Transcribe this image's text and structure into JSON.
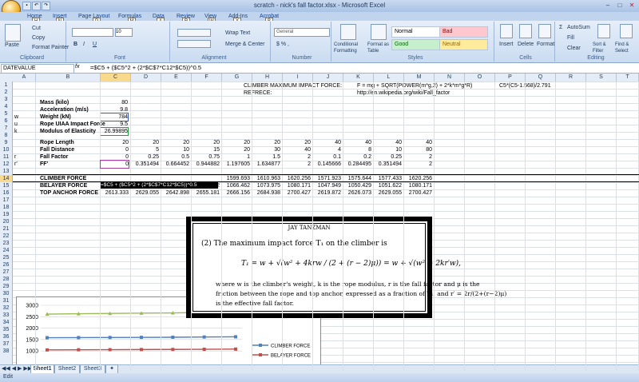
{
  "window": {
    "title": "scratch - nick's fall factor.xlsx - Microsoft Excel"
  },
  "tabs": [
    {
      "label": "Home",
      "key": "H"
    },
    {
      "label": "Insert",
      "key": "N"
    },
    {
      "label": "Page Layout",
      "key": "P"
    },
    {
      "label": "Formulas",
      "key": "M"
    },
    {
      "label": "Data",
      "key": "A"
    },
    {
      "label": "Review",
      "key": "R"
    },
    {
      "label": "View",
      "key": "W"
    },
    {
      "label": "Add-Ins",
      "key": "X"
    },
    {
      "label": "Acrobat",
      "key": "B"
    }
  ],
  "ribbon": {
    "clipboard": {
      "label": "Clipboard",
      "paste": "Paste",
      "cut": "Cut",
      "copy": "Copy",
      "format_painter": "Format Painter"
    },
    "font": {
      "label": "Font",
      "size": "10"
    },
    "alignment": {
      "label": "Alignment",
      "wrap": "Wrap Text",
      "merge": "Merge & Center"
    },
    "number": {
      "label": "Number",
      "format": "General"
    },
    "styles": {
      "label": "Styles",
      "conditional": "Conditional Formatting",
      "format_table": "Format as Table",
      "normal": "Normal",
      "bad": "Bad",
      "good": "Good",
      "neutral": "Neutral"
    },
    "cells": {
      "label": "Cells",
      "insert": "Insert",
      "delete": "Delete",
      "format": "Format"
    },
    "editing": {
      "label": "Editing",
      "autosum": "AutoSum",
      "fill": "Fill",
      "clear": "Clear",
      "sort": "Sort & Filter",
      "find": "Find & Select"
    }
  },
  "formula_bar": {
    "name_box": "DATEVALUE",
    "fx": "fx",
    "formula": "=$C5 + ($C5^2 + (2*$C$7*C12*$C5))^0.5"
  },
  "columns": [
    "A",
    "B",
    "C",
    "D",
    "E",
    "F",
    "G",
    "H",
    "I",
    "J",
    "K",
    "L",
    "M",
    "N",
    "O",
    "P",
    "Q",
    "R",
    "S",
    "T",
    "U"
  ],
  "rows": [
    "1",
    "2",
    "3",
    "4",
    "5",
    "6",
    "7",
    "8",
    "9",
    "10",
    "11",
    "12",
    "13",
    "14",
    "15",
    "16",
    "17",
    "18",
    "19",
    "20",
    "21",
    "22",
    "23",
    "24",
    "25",
    "26",
    "27",
    "28",
    "29",
    "30",
    "31",
    "32",
    "33",
    "34",
    "35",
    "36",
    "37",
    "38"
  ],
  "cells": {
    "h1": "CLIMBER MAXIMUM IMPACT FORCE:",
    "l1": "F = mg + SQRT(POWER(m*g,2) + 2*k*m*g*R)",
    "q1": "C5*(C5-1.568)/2.791",
    "h2": "REFRECE:",
    "l2": "http://en.wikipedia.org/wiki/Fall_factor",
    "b3": "Mass (kilo)",
    "c3": "80",
    "b4": "Acceleration (m/s)",
    "c4": "9.8",
    "a5": "w",
    "b5": "Weight (kN)",
    "c5": "784",
    "a6": "u",
    "b6": "Rope UIAA Impact Force",
    "c6": "9.5",
    "a7": "k",
    "b7": "Modulus of Elasticity",
    "c7": "26.99895"
  },
  "table": {
    "labels": [
      "Rope Length",
      "Fall Distance",
      "Fall Factor",
      "FF'"
    ],
    "row_letters": [
      "",
      "",
      "r",
      "r'"
    ],
    "values": [
      [
        "20",
        "20",
        "20",
        "20",
        "20",
        "20",
        "20",
        "40",
        "40",
        "40",
        "40"
      ],
      [
        "0",
        "5",
        "10",
        "15",
        "20",
        "30",
        "40",
        "4",
        "8",
        "10",
        "80"
      ],
      [
        "0",
        "0.25",
        "0.5",
        "0.75",
        "1",
        "1.5",
        "2",
        "0.1",
        "0.2",
        "0.25",
        "2"
      ],
      [
        "0",
        "0.351494",
        "0.664452",
        "0.944882",
        "1.197605",
        "1.634877",
        "2",
        "0.145666",
        "0.284495",
        "0.351494",
        "2"
      ]
    ]
  },
  "forces": {
    "labels": [
      "CLIMBER FORCE",
      "BELAYER FORCE",
      "TOP ANCHOR FORCE"
    ],
    "editing": "=$C5 + ($C5^2 + (2*$C$7*C12*$C5))^0.5",
    "values": [
      [
        "",
        "",
        "",
        "",
        "1599.693",
        "1610.963",
        "1620.256",
        "1571.923",
        "1575.644",
        "1577.433",
        "1620.256"
      ],
      [
        "1045.333",
        "1051.622",
        "1057.159",
        "1062.072",
        "1066.462",
        "1073.975",
        "1080.171",
        "1047.949",
        "1050.429",
        "1051.622",
        "1080.171"
      ],
      [
        "2613.333",
        "2629.055",
        "2642.898",
        "2655.181",
        "2666.156",
        "2684.938",
        "2700.427",
        "2619.872",
        "2626.073",
        "2629.055",
        "2700.427"
      ]
    ]
  },
  "chart_data": {
    "type": "line",
    "yticks": [
      "3000",
      "2500",
      "2000",
      "1500",
      "1000"
    ],
    "ylim": [
      900,
      3000
    ],
    "series": [
      {
        "name": "",
        "color": "#9bbb59",
        "values": [
          2613,
          2629,
          2643,
          2655,
          2666,
          2685,
          2700
        ]
      },
      {
        "name": "CLIMBER FORCE",
        "color": "#4f81bd",
        "values": [
          1580,
          1585,
          1590,
          1595,
          1600,
          1611,
          1620
        ]
      },
      {
        "name": "BELAYER FORCE",
        "color": "#c0504d",
        "values": [
          1045,
          1052,
          1057,
          1062,
          1066,
          1074,
          1080
        ]
      }
    ]
  },
  "overlay": {
    "header": "JAY TANZMAN",
    "intro": "(2)  The maximum impact force T₁ on the climber is",
    "equation": "T₁ = w + √(w² + 4krw / (2 + (r − 2)μ)) = w + √(w² + 2kr′w),",
    "body1": "where w is the climber's weight, k is the rope modulus, r is the fall factor and μ is the",
    "body2": "friction between the rope and top anchor, expressed as a fraction of T₁, and r′ = 2r/(2+(r−2)μ)",
    "body3": "is the effective fall factor."
  },
  "sheets": [
    "Sheet1",
    "Sheet2",
    "Sheet3"
  ],
  "status": {
    "mode": "Edit"
  }
}
